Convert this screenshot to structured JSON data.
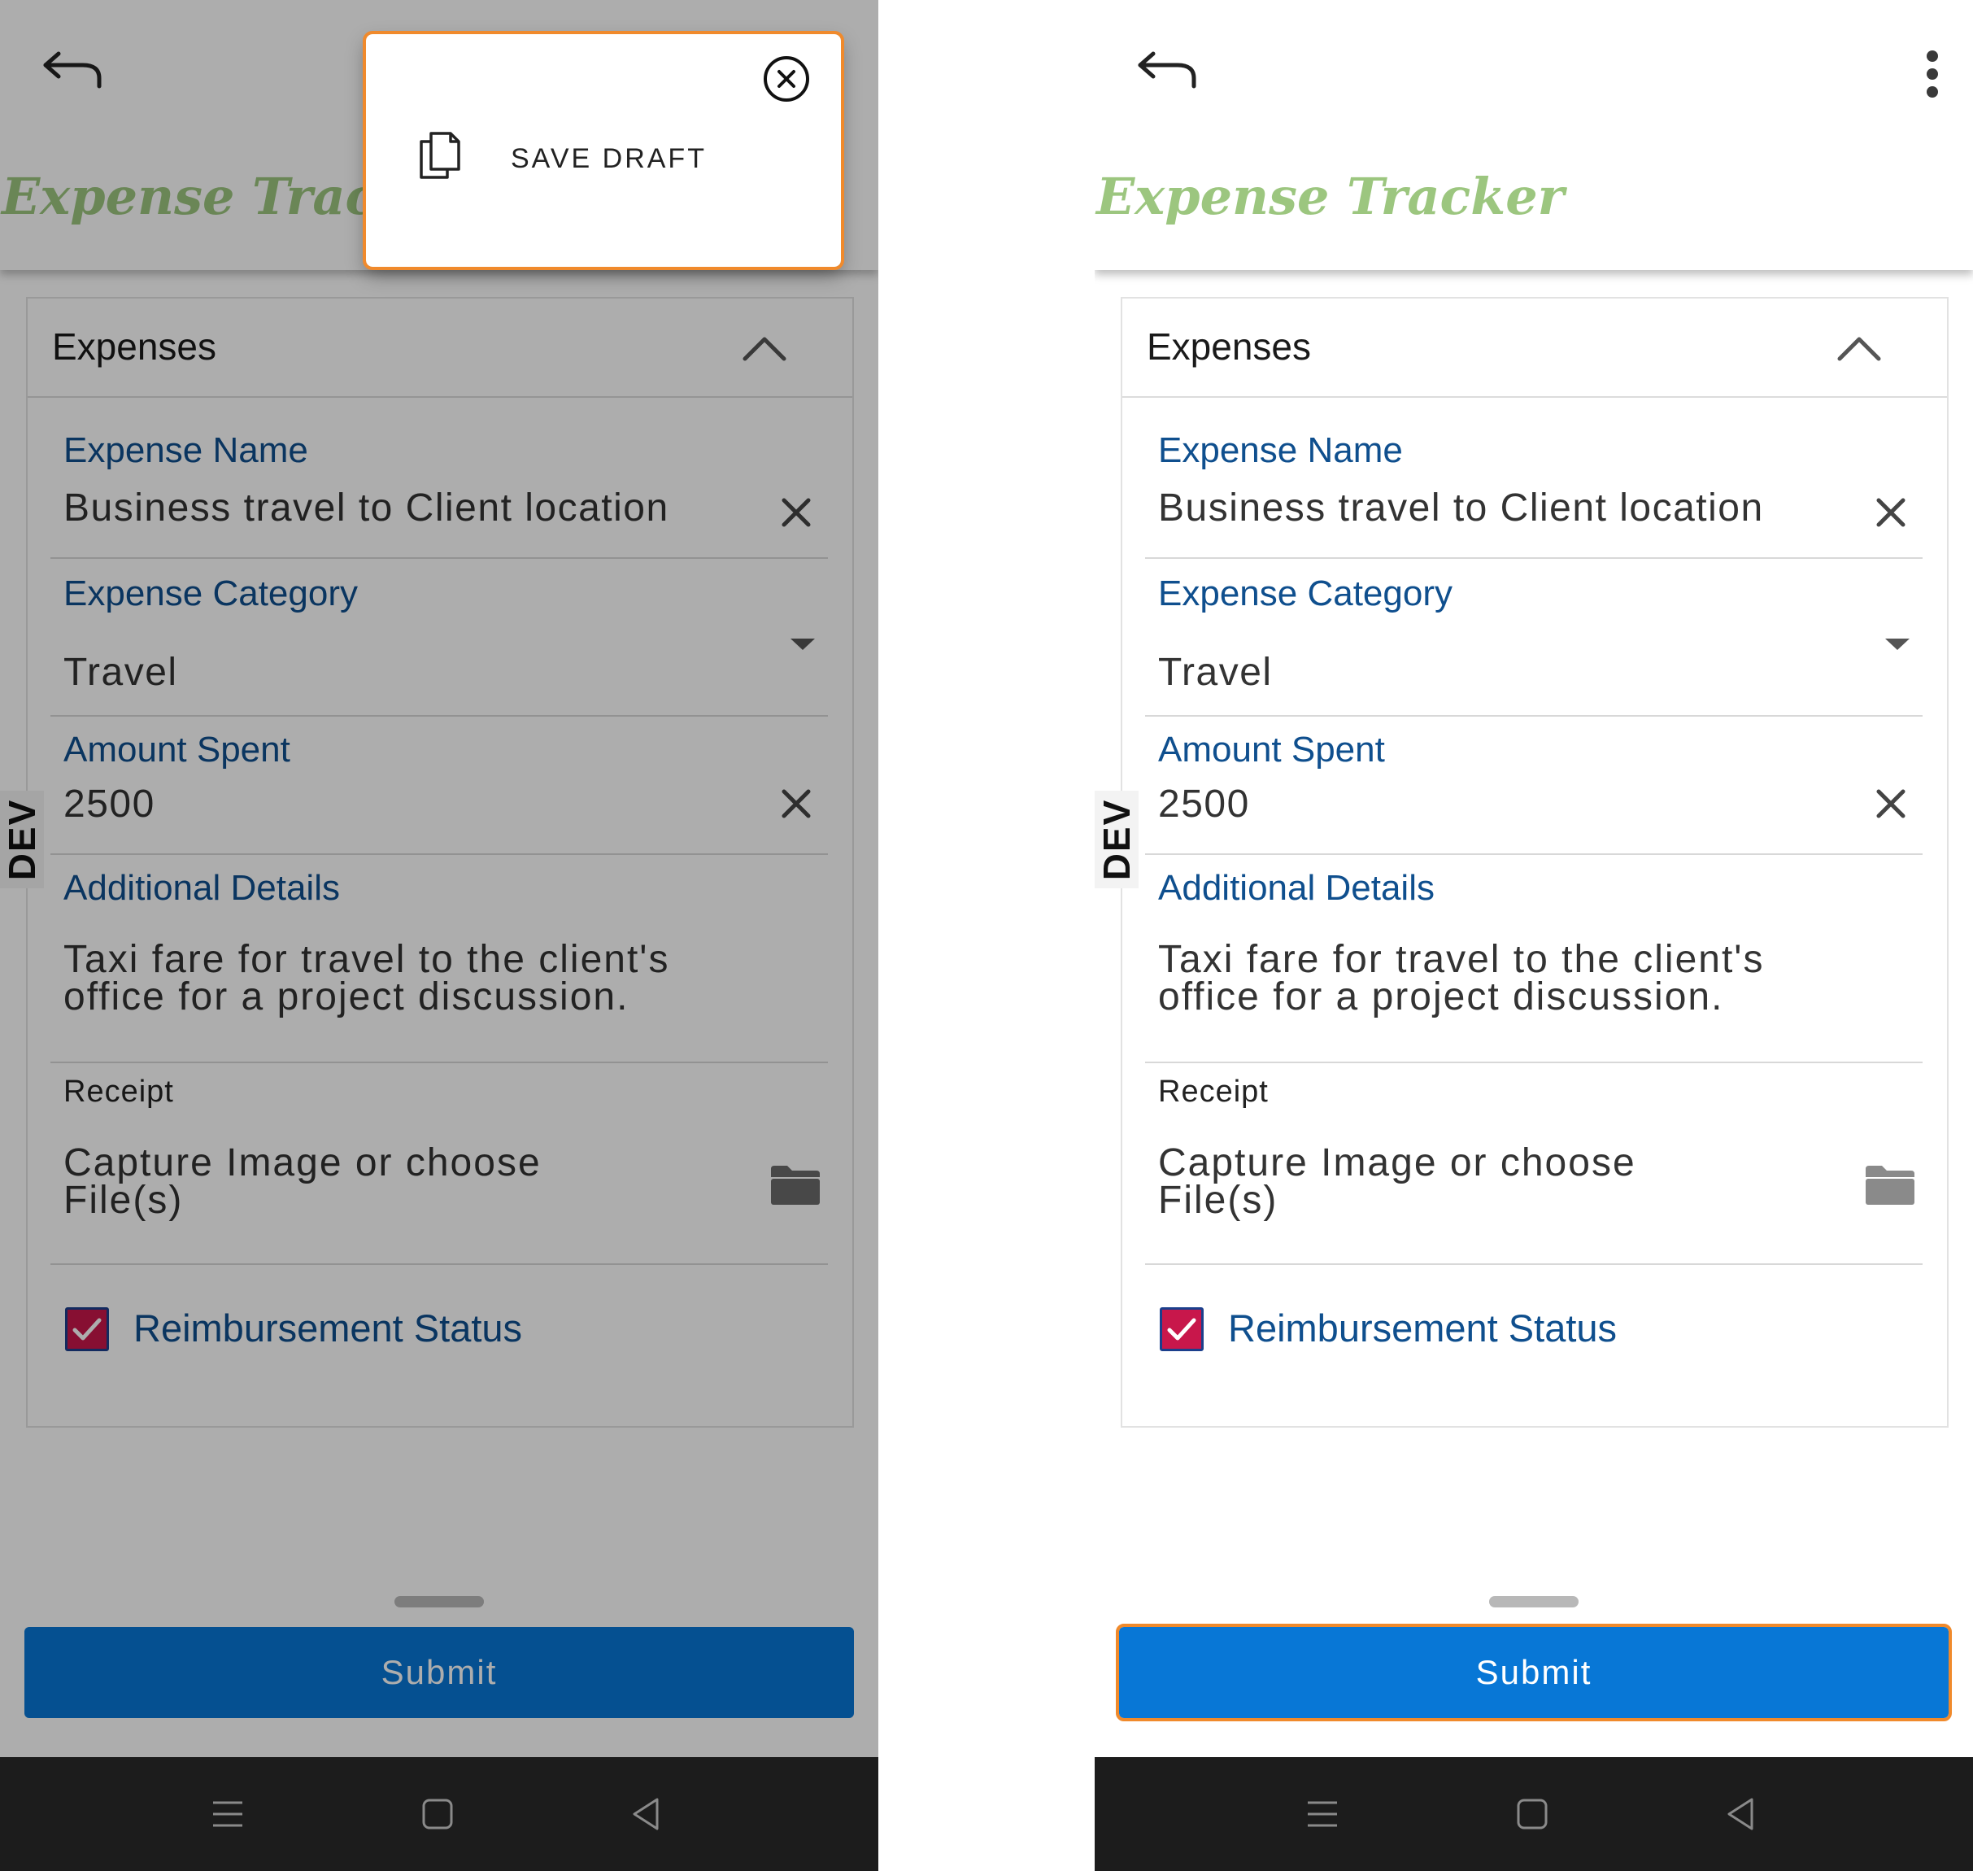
{
  "app": {
    "title": "Expense Tracker",
    "dev_tag": "DEV"
  },
  "popup": {
    "menu_item_label": "SAVE DRAFT"
  },
  "card": {
    "header_title": "Expenses",
    "fields": {
      "expense_name": {
        "label": "Expense Name",
        "value": "Business travel to Client location"
      },
      "expense_category": {
        "label": "Expense Category",
        "value": "Travel"
      },
      "amount_spent": {
        "label": "Amount Spent",
        "value": "2500"
      },
      "additional_details": {
        "label": "Additional Details",
        "value": "Taxi fare for travel to the client's office for a project discussion."
      },
      "receipt": {
        "label": "Receipt",
        "value": "Capture Image or choose File(s)"
      }
    },
    "reimbursement": {
      "label": "Reimbursement Status",
      "checked": true
    }
  },
  "footer": {
    "submit_label": "Submit"
  },
  "icons": {
    "back": "back-arrow-icon",
    "more": "more-vertical-icon",
    "collapse": "chevron-up-icon",
    "clear": "close-icon",
    "dropdown": "caret-down-icon",
    "folder": "folder-icon",
    "copy": "copy-icon",
    "popup_close": "circle-close-icon",
    "nav": [
      "recents-icon",
      "home-icon",
      "back-triangle-icon"
    ]
  },
  "colors": {
    "title_green": "#9cc67f",
    "label_blue": "#0f4f8e",
    "submit_blue": "#0877d6",
    "focus_orange": "#f08a2c",
    "checkbox_magenta": "#c8174b"
  }
}
